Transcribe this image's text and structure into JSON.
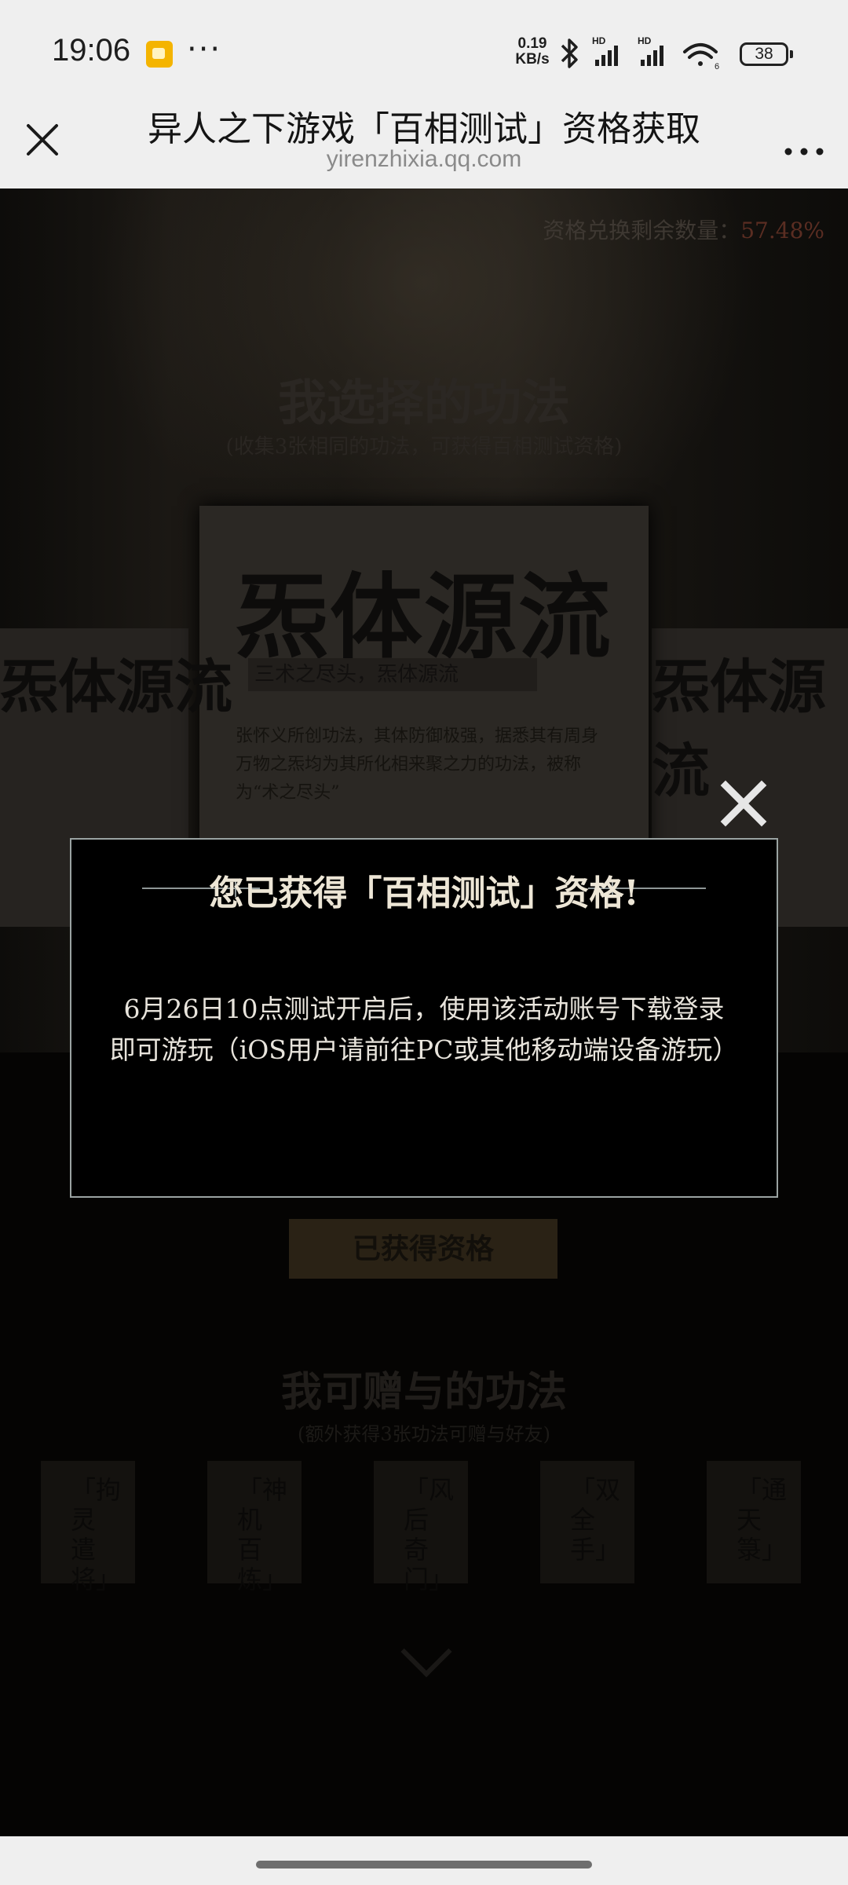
{
  "status_bar": {
    "time": "19:06",
    "notification_icon": "notes-app-icon",
    "more_indicator": "···",
    "net_speed_value": "0.19",
    "net_speed_unit": "KB/s",
    "icons": [
      "bluetooth-icon",
      "hd-signal-icon",
      "hd-signal-icon",
      "wifi-icon"
    ],
    "battery": "38"
  },
  "nav": {
    "title": "异人之下游戏「百相测试」资格获取",
    "domain": "yirenzhixia.qq.com"
  },
  "page": {
    "quota_label": "资格兑换剩余数量：",
    "quota_value": "57.48%",
    "section1_title": "我选择的功法",
    "section1_subtitle": "(收集3张相同的功法，可获得百相测试资格)",
    "card_title": "炁体源流",
    "side_card_title": "炁体源流",
    "card_tagline": "三术之尽头，炁体源流",
    "card_text": "张怀义所创功法，其体防御极强，据悉其有周身万物之炁均为其所化相来聚之力的功法，被称为“术之尽头”",
    "status_button": "已获得资格",
    "section2_title": "我可赠与的功法",
    "section2_subtitle": "(额外获得3张功法可赠与好友)",
    "gift_cards": [
      "「拘灵遣将」",
      "「神机百炼」",
      "「风后奇门」",
      "「双全手」",
      "「通天箓」"
    ]
  },
  "modal": {
    "title": "您已获得「百相测试」资格!",
    "body_line1": "6月26日10点测试开启后，使用该活动账号下载登录",
    "body_line2": "即可游玩（iOS用户请前往PC或其他移动端设备游玩）"
  },
  "colors": {
    "modal_border": "#9aa3a2",
    "modal_text": "#ede6d6",
    "chrome_bg": "#efefef"
  }
}
